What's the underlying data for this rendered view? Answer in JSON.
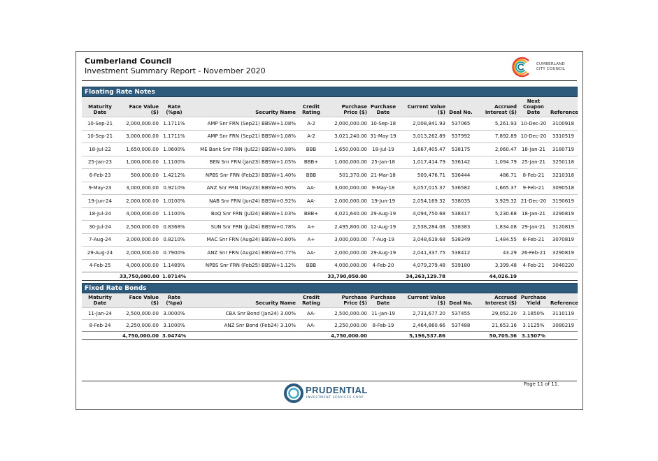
{
  "header": {
    "title": "Cumberland Council",
    "subtitle": "Investment Summary Report - November 2020",
    "council_logo_text": [
      "CUMBERLAND",
      "CITY COUNCIL"
    ]
  },
  "frn": {
    "section_title": "Floating Rate Notes",
    "columns": [
      "Maturity Date",
      "Face Value ($)",
      "Rate (%pa)",
      "Security Name",
      "Credit Rating",
      "Purchase Price ($)",
      "Purchase Date",
      "Current Value ($)",
      "Deal No.",
      "Accrued Interest ($)",
      "Next Coupon Date",
      "Reference"
    ],
    "rows": [
      [
        "10-Sep-21",
        "2,000,000.00",
        "1.1711%",
        "AMP Snr FRN (Sep21) BBSW+1.08%",
        "A-2",
        "2,000,000.00",
        "10-Sep-18",
        "2,008,841.93",
        "537065",
        "5,261.93",
        "10-Dec-20",
        "3100918"
      ],
      [
        "10-Sep-21",
        "3,000,000.00",
        "1.1711%",
        "AMP Snr FRN (Sep21) BBSW+1.08%",
        "A-2",
        "3,021,240.00",
        "31-May-19",
        "3,013,262.89",
        "537992",
        "7,892.89",
        "10-Dec-20",
        "3310519"
      ],
      [
        "18-Jul-22",
        "1,650,000.00",
        "1.0600%",
        "ME Bank Snr FRN (Jul22) BBSW+0.98%",
        "BBB",
        "1,650,000.00",
        "18-Jul-19",
        "1,667,405.47",
        "538175",
        "2,060.47",
        "18-Jan-21",
        "3180719"
      ],
      [
        "25-Jan-23",
        "1,000,000.00",
        "1.1100%",
        "BEN Snr FRN (Jan23) BBSW+1.05%",
        "BBB+",
        "1,000,000.00",
        "25-Jan-18",
        "1,017,414.79",
        "536142",
        "1,094.79",
        "25-Jan-21",
        "3250118"
      ],
      [
        "6-Feb-23",
        "500,000.00",
        "1.4212%",
        "NPBS Snr FRN (Feb23) BBSW+1.40%",
        "BBB",
        "501,370.00",
        "21-Mar-18",
        "509,476.71",
        "536444",
        "486.71",
        "8-Feb-21",
        "3210318"
      ],
      [
        "9-May-23",
        "3,000,000.00",
        "0.9210%",
        "ANZ Snr FRN (May23) BBSW+0.90%",
        "AA-",
        "3,000,000.00",
        "9-May-18",
        "3,057,015.37",
        "536582",
        "1,665.37",
        "9-Feb-21",
        "3090518"
      ],
      [
        "19-Jun-24",
        "2,000,000.00",
        "1.0100%",
        "NAB Snr FRN (Jun24) BBSW+0.92%",
        "AA-",
        "2,000,000.00",
        "19-Jun-19",
        "2,054,169.32",
        "538035",
        "3,929.32",
        "21-Dec-20",
        "3190619"
      ],
      [
        "18-Jul-24",
        "4,000,000.00",
        "1.1100%",
        "BoQ Snr FRN (Jul24) BBSW+1.03%",
        "BBB+",
        "4,021,640.00",
        "29-Aug-19",
        "4,094,750.68",
        "538417",
        "5,230.68",
        "18-Jan-21",
        "3290819"
      ],
      [
        "30-Jul-24",
        "2,500,000.00",
        "0.8368%",
        "SUN Snr FRN (Jul24) BBSW+0.78%",
        "A+",
        "2,495,800.00",
        "12-Aug-19",
        "2,538,284.08",
        "538383",
        "1,834.08",
        "29-Jan-21",
        "3120819"
      ],
      [
        "7-Aug-24",
        "3,000,000.00",
        "0.8210%",
        "MAC Snr FRN (Aug24) BBSW+0.80%",
        "A+",
        "3,000,000.00",
        "7-Aug-19",
        "3,048,619.68",
        "538349",
        "1,484.55",
        "8-Feb-21",
        "3070819"
      ],
      [
        "29-Aug-24",
        "2,000,000.00",
        "0.7900%",
        "ANZ Snr FRN (Aug24) BBSW+0.77%",
        "AA-",
        "2,000,000.00",
        "29-Aug-19",
        "2,041,337.75",
        "538412",
        "43.29",
        "26-Feb-21",
        "3290819"
      ],
      [
        "4-Feb-25",
        "4,000,000.00",
        "1.1489%",
        "NPBS Snr FRN (Feb25) BBSW+1.12%",
        "BBB",
        "4,000,000.00",
        "4-Feb-20",
        "4,079,279.48",
        "539180",
        "3,399.48",
        "4-Feb-21",
        "3040220"
      ]
    ],
    "totals": [
      "",
      "33,750,000.00",
      "1.0714%",
      "",
      "",
      "33,790,050.00",
      "",
      "34,263,129.78",
      "",
      "44,026.19",
      "",
      ""
    ]
  },
  "frb": {
    "section_title": "Fixed Rate Bonds",
    "columns": [
      "Maturity Date",
      "Face Value ($)",
      "Rate (%pa)",
      "Security Name",
      "Credit Rating",
      "Purchase Price ($)",
      "Purchase Date",
      "Current Value ($)",
      "Deal No.",
      "Accrued Interest ($)",
      "Purchase Yield",
      "Reference"
    ],
    "rows": [
      [
        "11-Jan-24",
        "2,500,000.00",
        "3.0000%",
        "CBA Snr Bond (Jan24) 3.00%",
        "AA-",
        "2,500,000.00",
        "11-Jan-19",
        "2,731,677.20",
        "537455",
        "29,052.20",
        "3.1850%",
        "3110119"
      ],
      [
        "8-Feb-24",
        "2,250,000.00",
        "3.1000%",
        "ANZ Snr Bond (Feb24) 3.10%",
        "AA-",
        "2,250,000.00",
        "8-Feb-19",
        "2,464,860.66",
        "537488",
        "21,653.16",
        "3.1125%",
        "3080219"
      ]
    ],
    "totals": [
      "",
      "4,750,000.00",
      "3.0474%",
      "",
      "",
      "4,750,000.00",
      "",
      "5,196,537.86",
      "",
      "50,705.36",
      "3.1507%",
      ""
    ]
  },
  "footer": {
    "brand_name": "PRUDENTIAL",
    "brand_tagline": "INVESTMENT SERVICES CORP",
    "page_number": "Page 11 of 11."
  },
  "colors": {
    "section_bar": "#2e5a7c",
    "header_bg": "#e8e8e8"
  }
}
